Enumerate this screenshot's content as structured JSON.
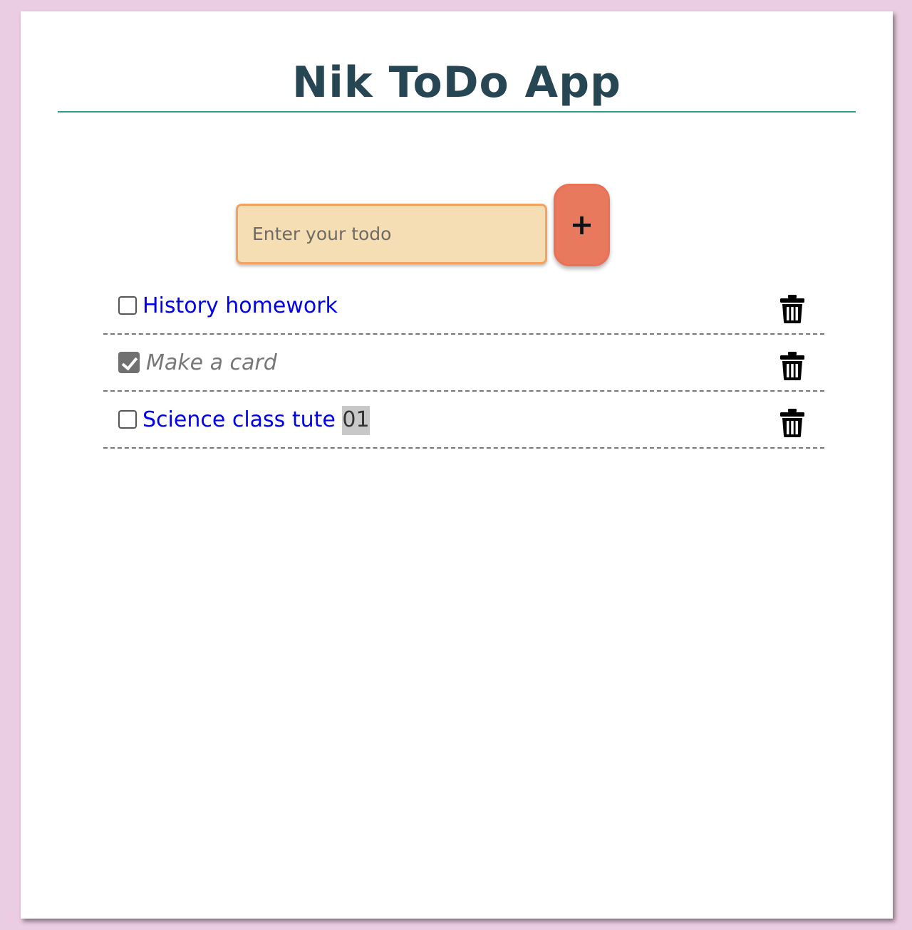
{
  "header": {
    "title": "Nik ToDo App"
  },
  "input": {
    "placeholder": "Enter your todo",
    "value": ""
  },
  "add_button": {
    "label": "+"
  },
  "todos": [
    {
      "text": "History homework",
      "highlight": "",
      "completed": false
    },
    {
      "text": "Make a card",
      "highlight": "",
      "completed": true
    },
    {
      "text": "Science class tute ",
      "highlight": "01",
      "completed": false
    }
  ],
  "colors": {
    "background": "#ebcde3",
    "title": "#264653",
    "rule": "#2a9d8f",
    "input_bg": "#f5deb3",
    "input_border": "#f4a261",
    "add_button": "#e76f51",
    "todo_text": "#0000ee",
    "todo_done": "#777777"
  },
  "icons": {
    "add": "plus-icon",
    "delete": "trash-icon"
  }
}
